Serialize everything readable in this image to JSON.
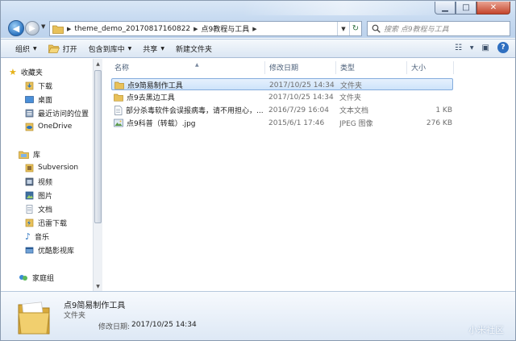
{
  "window": {
    "minimize_glyph": "▁",
    "maximize_glyph": "□",
    "close_glyph": "✕"
  },
  "nav": {
    "back_glyph": "◀",
    "forward_glyph": "▶",
    "history_glyph": "▼"
  },
  "address": {
    "crumbs": [
      "theme_demo_20170817160822",
      "点9教程与工具"
    ],
    "separator": "▶",
    "dropdown_glyph": "▼",
    "refresh_glyph": "↻"
  },
  "search": {
    "placeholder": "搜索 点9教程与工具"
  },
  "toolbar": {
    "organize": "组织",
    "open": "打开",
    "include_in_library": "包含到库中",
    "share": "共享",
    "new_folder": "新建文件夹",
    "caret": "▼",
    "view_glyph": "☷",
    "view_caret": "▼",
    "preview_glyph": "▣",
    "help_glyph": "?"
  },
  "navpane": {
    "favorites": {
      "title": "收藏夹",
      "items": [
        "下载",
        "桌面",
        "最近访问的位置",
        "OneDrive"
      ]
    },
    "libraries": {
      "title": "库",
      "items": [
        "Subversion",
        "视频",
        "图片",
        "文档",
        "迅雷下载",
        "音乐",
        "优酷影视库"
      ]
    },
    "homegroup": "家庭组",
    "scroll_up": "▲",
    "scroll_down": "▼"
  },
  "columns": {
    "name": "名称",
    "date": "修改日期",
    "type": "类型",
    "size": "大小",
    "sort_glyph": "▲"
  },
  "files": [
    {
      "name": "点9简易制作工具",
      "date": "2017/10/25 14:34",
      "type": "文件夹",
      "size": "",
      "icon": "folder-icon"
    },
    {
      "name": "点9去黑边工具",
      "date": "2017/10/25 14:34",
      "type": "文件夹",
      "size": "",
      "icon": "folder-icon"
    },
    {
      "name": "部分杀毒软件会误报病毒，请不用担心，...",
      "date": "2016/7/29 16:04",
      "type": "文本文档",
      "size": "1 KB",
      "icon": "text-file-icon"
    },
    {
      "name": "点9科普（转载）.jpg",
      "date": "2015/6/1 17:46",
      "type": "JPEG 图像",
      "size": "276 KB",
      "icon": "image-file-icon"
    }
  ],
  "details": {
    "name": "点9简易制作工具",
    "type": "文件夹",
    "modified_label": "修改日期:",
    "modified_value": "2017/10/25 14:34",
    "watermark": "小米社区"
  },
  "colors": {
    "selection": "#cde3fa",
    "selection_border": "#84acdd",
    "folder": "#e8c15a",
    "chrome": "#c8dbf1"
  }
}
